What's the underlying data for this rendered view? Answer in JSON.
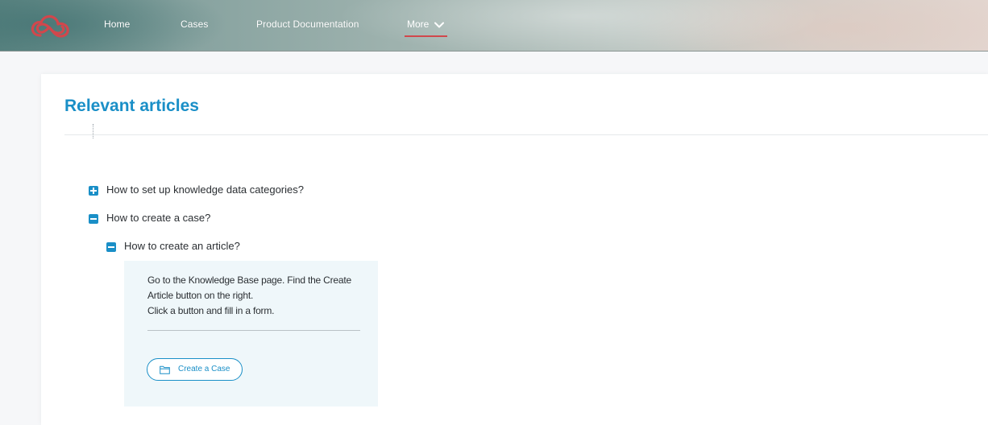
{
  "header": {
    "logo_icon": "cloud-infinity-icon",
    "nav": [
      {
        "label": "Home"
      },
      {
        "label": "Cases"
      },
      {
        "label": "Product Documentation"
      },
      {
        "label": "More"
      }
    ],
    "active_indicator_color": "#d1474c"
  },
  "main": {
    "title": "Relevant articles",
    "tree": [
      {
        "label": "How to set up knowledge data categories?",
        "state": "collapsed",
        "icon": "plus-square-icon"
      },
      {
        "label": "How to create a case?",
        "state": "expanded",
        "icon": "minus-square-icon"
      },
      {
        "label": "How to create an article?",
        "state": "expanded",
        "icon": "minus-square-icon"
      }
    ],
    "article": {
      "lines": [
        "Go to the Knowledge Base page. Find the Create",
        "Article button on the right.",
        "Click a button and fill in a form."
      ],
      "button_label": "Create a Case",
      "button_icon": "folder-icon"
    }
  },
  "colors": {
    "accent": "#1a8fc7",
    "article_bg": "#eff7fa"
  }
}
